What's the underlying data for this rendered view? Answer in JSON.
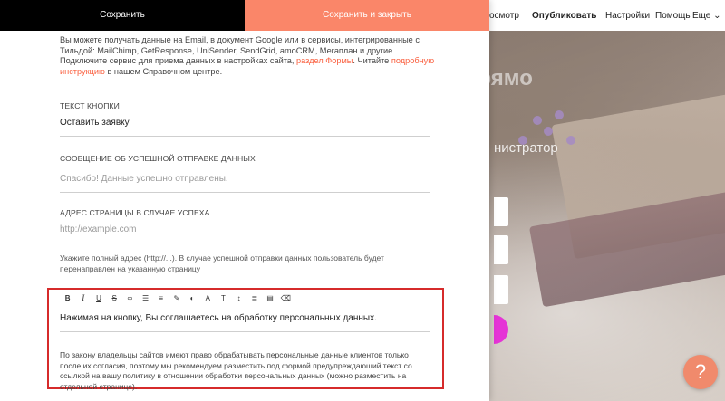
{
  "top_buttons": {
    "save": "Сохранить",
    "save_close": "Сохранить и закрыть"
  },
  "nav": {
    "view": "осмотр",
    "publish": "Опубликовать",
    "settings": "Настройки",
    "help": "Помощь",
    "more": "Еще ⌄"
  },
  "intro": {
    "text_before_link1": "Вы можете получать данные на Email, в документ Google или в сервисы, интегрированные с Тильдой: MailChimp, GetResponse, UniSender, SendGrid, amoCRM, Мегаплан и другие. Подключите сервис для приема данных в настройках сайта, ",
    "link1": "раздел Формы",
    "text_between": ". Читайте ",
    "link2": "подробную инструкцию",
    "text_after": " в нашем Справочном центре."
  },
  "fields": {
    "button_text": {
      "label": "ТЕКСТ КНОПКИ",
      "value": "Оставить заявку"
    },
    "success_message": {
      "label": "СООБЩЕНИЕ ОБ УСПЕШНОЙ ОТПРАВКЕ ДАННЫХ",
      "placeholder": "Спасибо! Данные успешно отправлены."
    },
    "success_url": {
      "label": "АДРЕС СТРАНИЦЫ В СЛУЧАЕ УСПЕХА",
      "placeholder": "http://example.com",
      "hint": "Укажите полный адрес (http://...). В случае успешной отправки данных пользователь будет перенаправлен на указанную страницу"
    }
  },
  "editor": {
    "toolbar": [
      {
        "name": "bold",
        "glyph": "B"
      },
      {
        "name": "italic",
        "glyph": "I"
      },
      {
        "name": "underline",
        "glyph": "U"
      },
      {
        "name": "strikethrough",
        "glyph": "S"
      },
      {
        "name": "link",
        "glyph": "∞"
      },
      {
        "name": "bullet-list",
        "glyph": "☰"
      },
      {
        "name": "numbered-list",
        "glyph": "≡"
      },
      {
        "name": "brush",
        "glyph": "✎"
      },
      {
        "name": "contrast",
        "glyph": "◐"
      },
      {
        "name": "font",
        "glyph": "A"
      },
      {
        "name": "text-size",
        "glyph": "T"
      },
      {
        "name": "line-height",
        "glyph": "↕"
      },
      {
        "name": "align",
        "glyph": "≣"
      },
      {
        "name": "typography",
        "glyph": "▤"
      },
      {
        "name": "clear-format",
        "glyph": "⌫"
      }
    ],
    "main_text": "Нажимая на кнопку, Вы соглашаетесь на обработку персональных данных.",
    "note": "По закону владельцы сайтов имеют право обрабатывать персональные данные клиентов только после их согласия, поэтому мы рекомендуем разместить под формой предупреждающий текст со ссылкой на вашу политику в отношении обработки персональных данных (можно разместить на отдельной странице)."
  },
  "background": {
    "heading": "Станьте еще красивее прямо сейчас",
    "subtitle": "нистратор"
  },
  "help_button": "?",
  "colors": {
    "accent": "#fa8669",
    "highlight_border": "#d62b2b",
    "link": "#fa5d3c",
    "submit": "#e534d6"
  }
}
